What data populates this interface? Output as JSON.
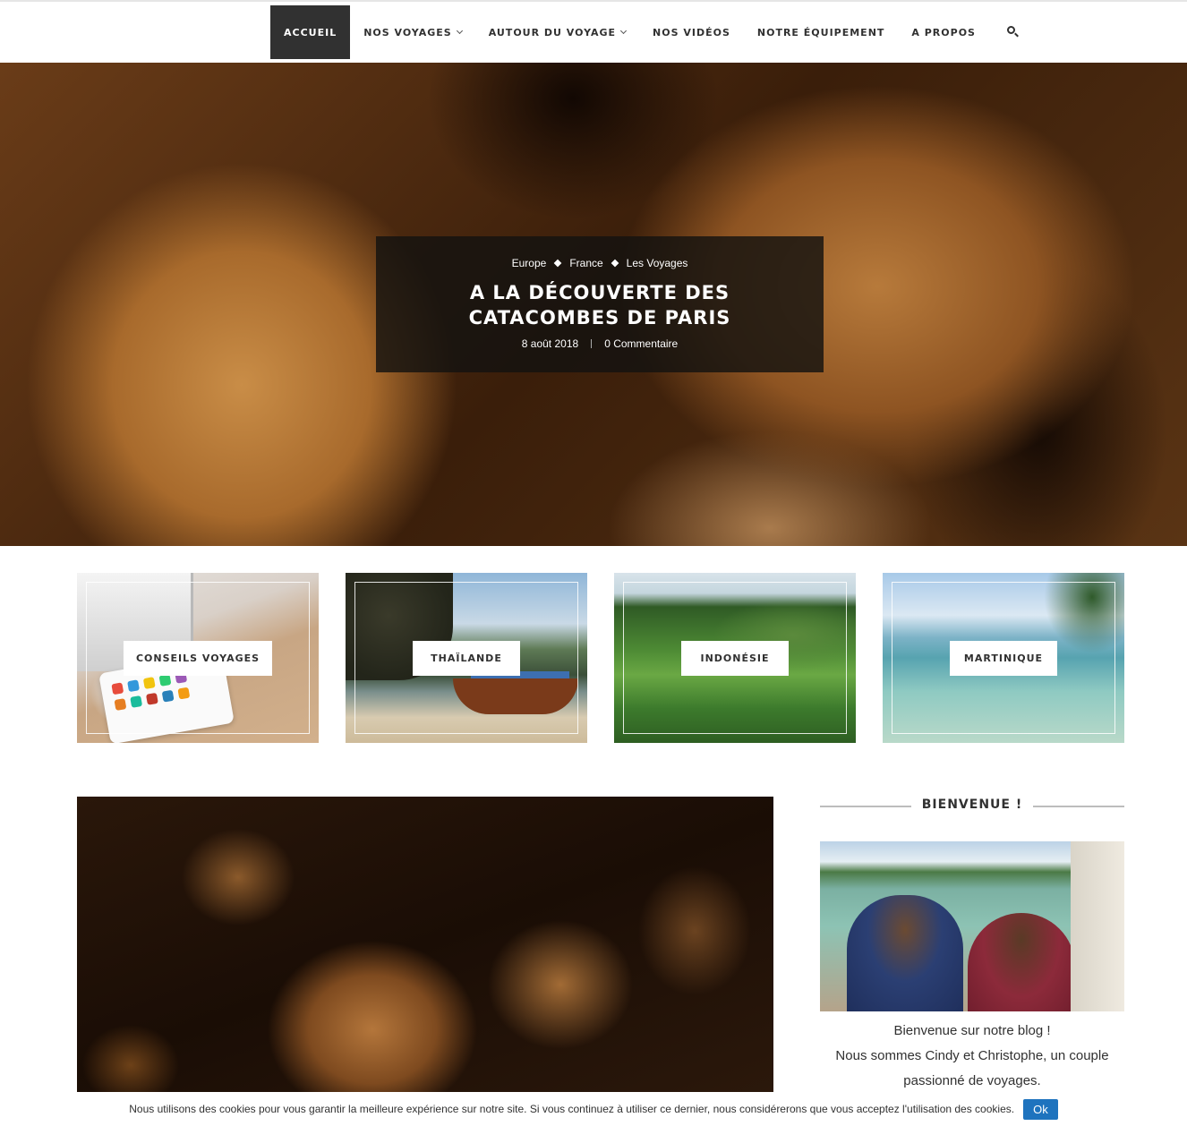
{
  "nav": {
    "items": [
      {
        "label": "ACCUEIL"
      },
      {
        "label": "NOS VOYAGES"
      },
      {
        "label": "AUTOUR DU VOYAGE"
      },
      {
        "label": "NOS VIDÉOS"
      },
      {
        "label": "NOTRE ÉQUIPEMENT"
      },
      {
        "label": "A PROPOS"
      }
    ],
    "active": "ACCUEIL",
    "search_icon": "search-icon"
  },
  "hero": {
    "categories": [
      "Europe",
      "France",
      "Les Voyages"
    ],
    "title": "A LA DÉCOUVERTE DES CATACOMBES DE PARIS",
    "date": "8 août 2018",
    "comments": "0 Commentaire"
  },
  "tiles": [
    {
      "label": "CONSEILS VOYAGES"
    },
    {
      "label": "THAÏLANDE"
    },
    {
      "label": "INDONÉSIE"
    },
    {
      "label": "MARTINIQUE"
    }
  ],
  "sidebar": {
    "widget_title": "BIENVENUE !",
    "line1": "Bienvenue sur notre blog !",
    "line2": "Nous sommes Cindy et Christophe, un couple passionné de voyages."
  },
  "cookie": {
    "text": "Nous utilisons des cookies pour vous garantir la meilleure expérience sur notre site. Si vous continuez à utiliser ce dernier, nous considérerons que vous acceptez l'utilisation des cookies.",
    "button": "Ok"
  },
  "colors": {
    "nav_active_bg": "#313131",
    "cookie_button": "#1e73be"
  }
}
